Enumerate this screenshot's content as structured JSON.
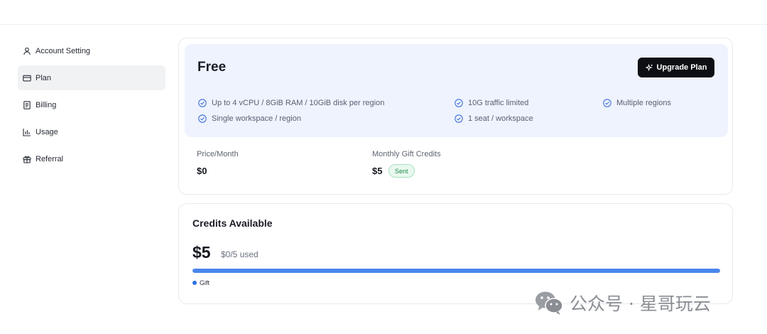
{
  "sidebar": {
    "items": [
      {
        "label": "Account Setting",
        "icon": "user-icon",
        "active": false
      },
      {
        "label": "Plan",
        "icon": "credit-card-icon",
        "active": true
      },
      {
        "label": "Billing",
        "icon": "document-icon",
        "active": false
      },
      {
        "label": "Usage",
        "icon": "bar-chart-icon",
        "active": false
      },
      {
        "label": "Referral",
        "icon": "gift-icon",
        "active": false
      }
    ]
  },
  "plan": {
    "name": "Free",
    "upgrade_label": "Upgrade Plan",
    "features": [
      "Up to 4 vCPU / 8GiB RAM / 10GiB disk per region",
      "Single workspace / region",
      "10G traffic limited",
      "1 seat / workspace",
      "Multiple regions"
    ],
    "price_label": "Price/Month",
    "price_value": "$0",
    "gift_label": "Monthly Gift Credits",
    "gift_value": "$5",
    "gift_status": "Sent"
  },
  "credits": {
    "title": "Credits Available",
    "amount": "$5",
    "used": "$0/5 used",
    "progress_fraction": 1.0,
    "legend": "Gift"
  },
  "colors": {
    "accent": "#4a86ec",
    "hero_bg": "#eef3fe",
    "check": "#3f6fd8",
    "sent_green": "#1f8a4c"
  },
  "watermark": "公众号 · 星哥玩云"
}
